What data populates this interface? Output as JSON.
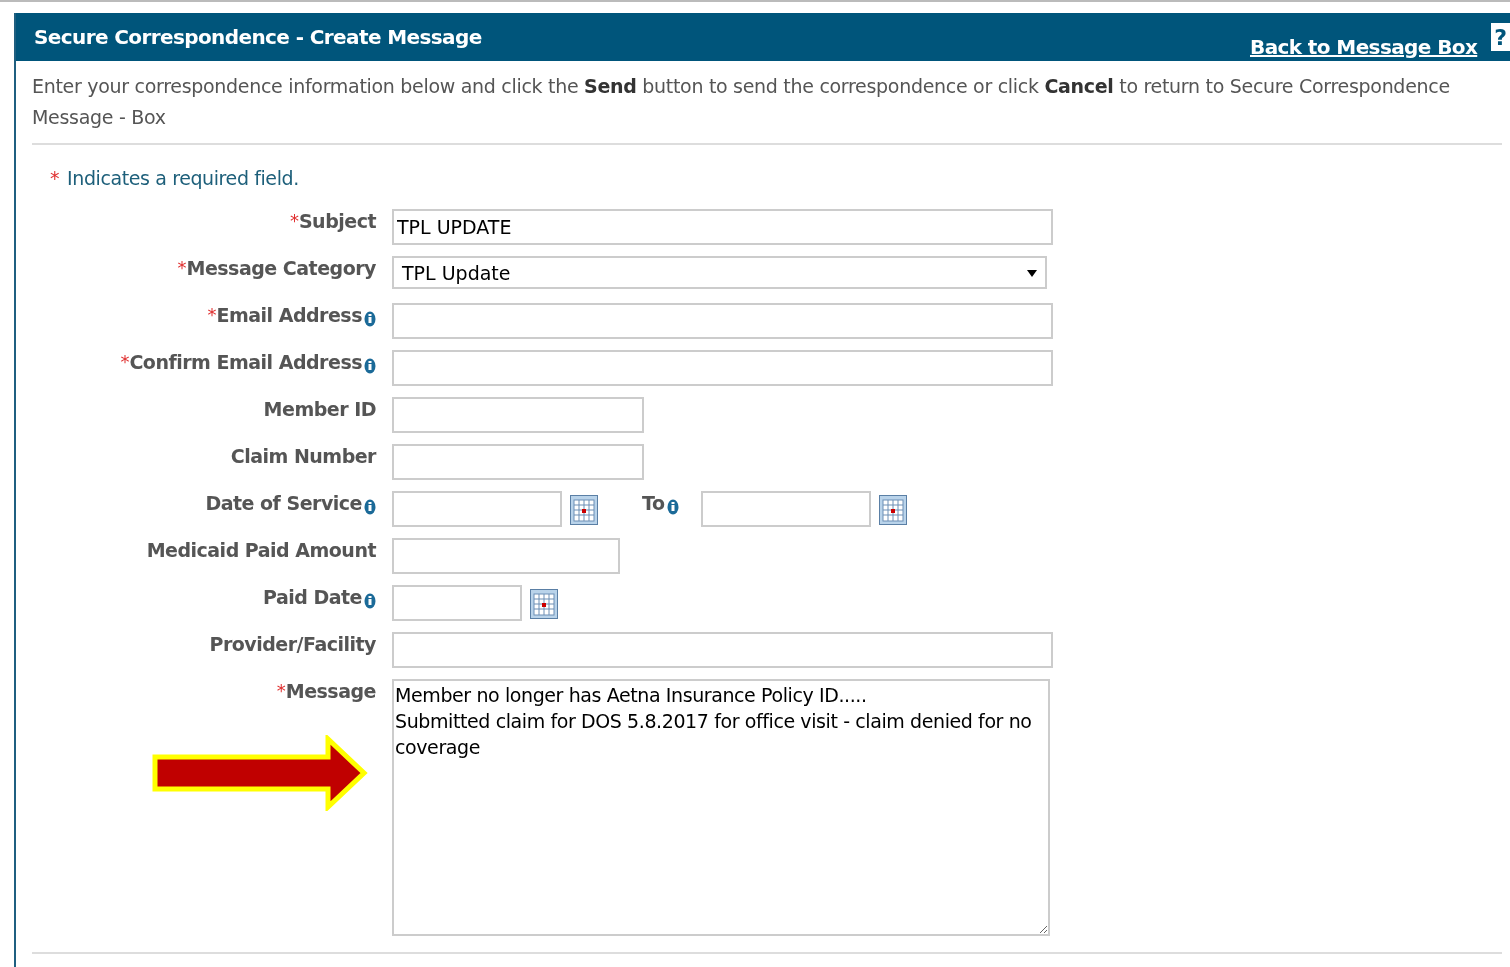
{
  "header": {
    "title": "Secure Correspondence - Create Message",
    "back_link": "Back to Message Box",
    "help": "?"
  },
  "intro": "Enter your correspondence information below and click the **Send** button to send the correspondence or click **Cancel** to return to Secure Correspondence Message - Box",
  "required_note": {
    "mark": "*",
    "text": "Indicates a required field."
  },
  "fields": [
    {
      "kind": "long",
      "label": "Subject",
      "required": true,
      "info": false,
      "value": "TPL UPDATE"
    },
    {
      "kind": "select",
      "label": "Message Category",
      "required": true,
      "info": false,
      "value": "TPL Update"
    },
    {
      "kind": "long",
      "label": "Email Address",
      "required": true,
      "info": true
    },
    {
      "kind": "long",
      "label": "Confirm Email Address",
      "required": true,
      "info": true
    },
    {
      "kind": "medium",
      "label": "Member ID",
      "required": false,
      "info": false
    },
    {
      "kind": "medium",
      "label": "Claim Number",
      "required": false,
      "info": false
    },
    {
      "kind": "date-range",
      "label": "Date of Service",
      "required": false,
      "info": true,
      "to_label": "To"
    },
    {
      "kind": "amount",
      "label": "Medicaid Paid Amount",
      "required": false,
      "info": false
    },
    {
      "kind": "date",
      "label": "Paid Date",
      "required": false,
      "info": true
    },
    {
      "kind": "long",
      "label": "Provider/Facility",
      "required": false,
      "info": false
    },
    {
      "kind": "textarea",
      "label": "Message",
      "required": true,
      "info": false,
      "value": "Member no longer has Aetna Insurance Policy ID.....\nSubmitted claim for DOS 5.8.2017 for office visit - claim denied for no coverage"
    }
  ]
}
